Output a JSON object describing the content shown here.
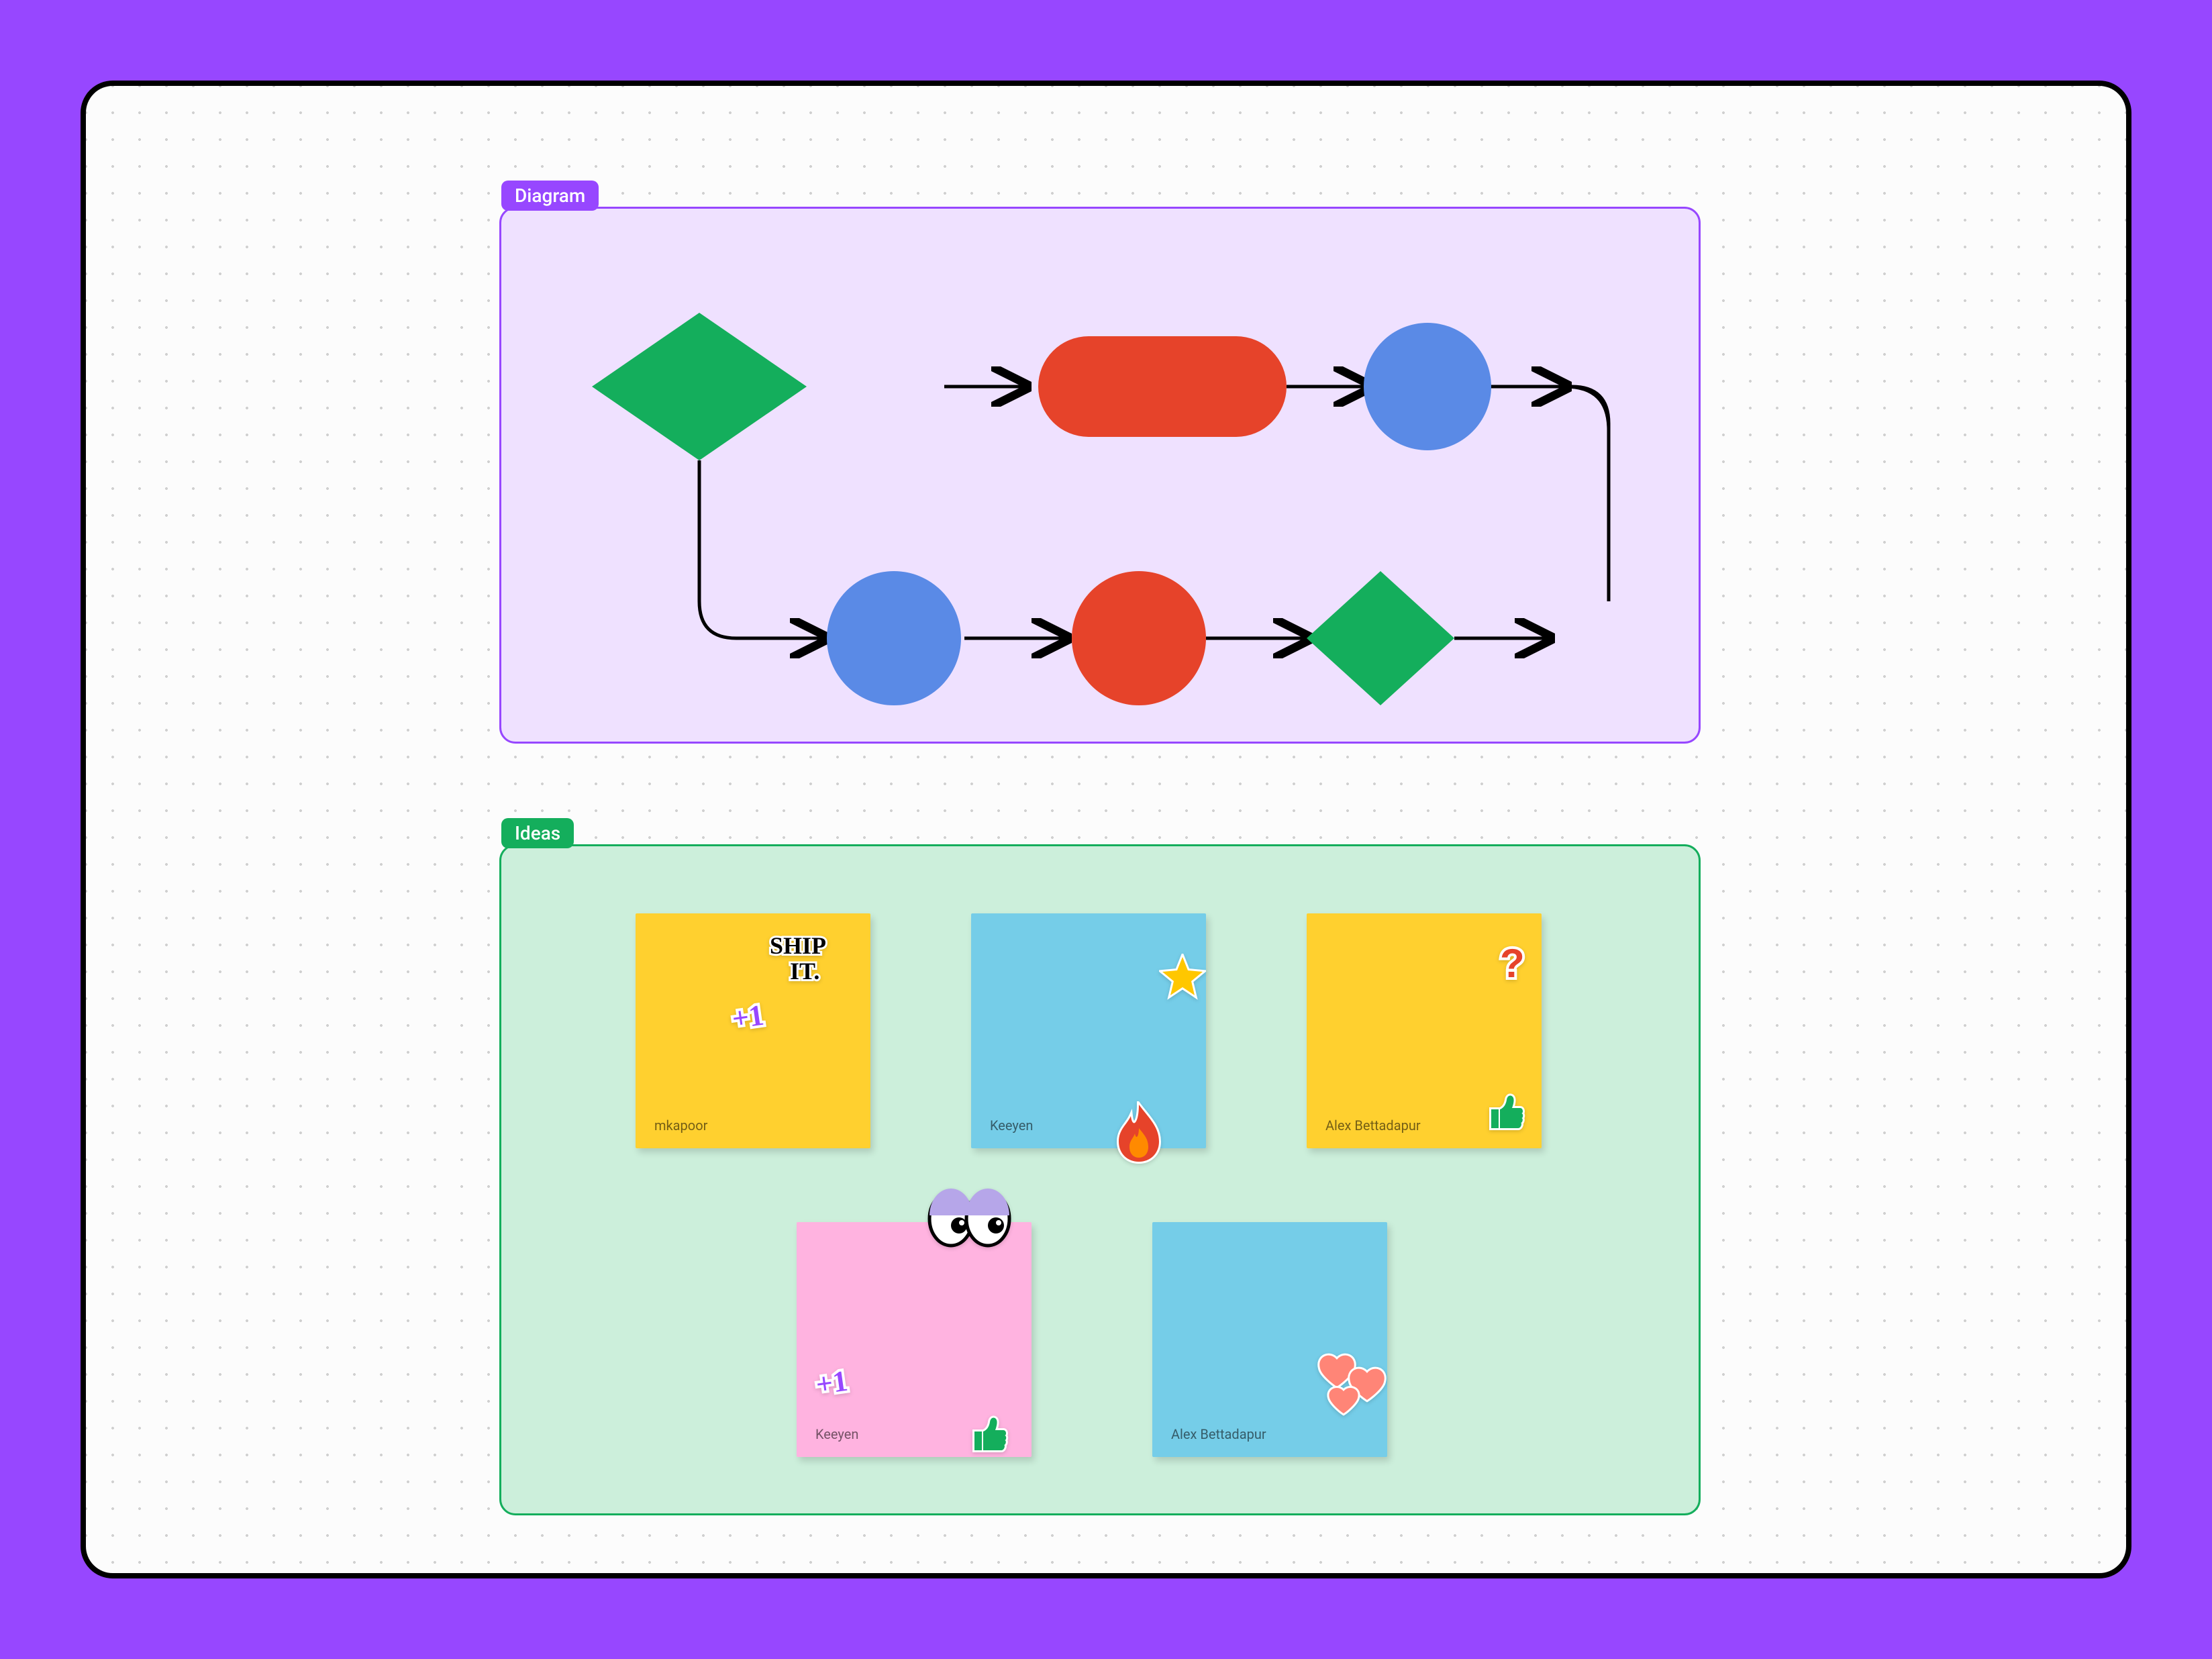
{
  "sections": {
    "diagram": {
      "label": "Diagram"
    },
    "ideas": {
      "label": "Ideas"
    }
  },
  "diagram": {
    "shapes": [
      {
        "type": "diamond",
        "color": "#14AE5C"
      },
      {
        "type": "rounded-rect",
        "color": "#E6432A"
      },
      {
        "type": "circle",
        "color": "#5A8AE6"
      },
      {
        "type": "circle",
        "color": "#5A8AE6"
      },
      {
        "type": "circle",
        "color": "#E6432A"
      },
      {
        "type": "diamond",
        "color": "#14AE5C"
      }
    ]
  },
  "stickies": [
    {
      "author": "mkapoor",
      "color": "yellow",
      "stickers": [
        "ship-it",
        "plus-one"
      ]
    },
    {
      "author": "Keeyen",
      "color": "blue",
      "stickers": [
        "star",
        "fire"
      ]
    },
    {
      "author": "Alex Bettadapur",
      "color": "yellow",
      "stickers": [
        "question",
        "thumbs-up"
      ]
    },
    {
      "author": "Keeyen",
      "color": "pink",
      "stickers": [
        "eyes",
        "plus-one",
        "thumbs-up"
      ]
    },
    {
      "author": "Alex Bettadapur",
      "color": "blue",
      "stickers": [
        "hearts"
      ]
    }
  ],
  "colors": {
    "page_bg": "#9747FF",
    "diagram_fill": "#EFE1FF",
    "diagram_border": "#9747FF",
    "ideas_fill": "#CCEFDB",
    "ideas_border": "#14AE5C",
    "shape_green": "#14AE5C",
    "shape_red": "#E6432A",
    "shape_blue": "#5A8AE6",
    "sticky_yellow": "#FFD02F",
    "sticky_blue": "#75CDE8",
    "sticky_pink": "#FFB3E0"
  }
}
